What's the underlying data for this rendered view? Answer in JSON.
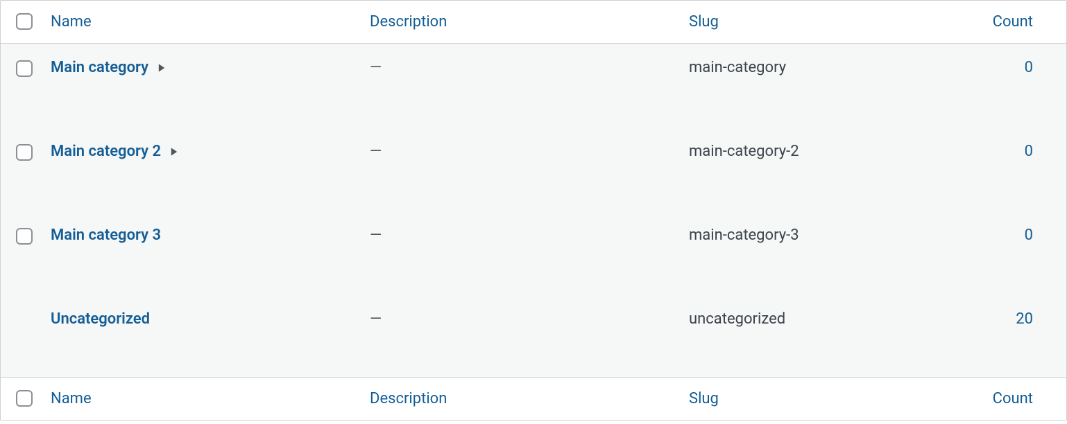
{
  "columns": {
    "name": "Name",
    "description": "Description",
    "slug": "Slug",
    "count": "Count"
  },
  "rows": [
    {
      "has_checkbox": true,
      "name": "Main category",
      "expandable": true,
      "description": "—",
      "slug": "main-category",
      "count": "0"
    },
    {
      "has_checkbox": true,
      "name": "Main category 2",
      "expandable": true,
      "description": "—",
      "slug": "main-category-2",
      "count": "0"
    },
    {
      "has_checkbox": true,
      "name": "Main category 3",
      "expandable": false,
      "description": "—",
      "slug": "main-category-3",
      "count": "0"
    },
    {
      "has_checkbox": false,
      "name": "Uncategorized",
      "expandable": false,
      "description": "—",
      "slug": "uncategorized",
      "count": "20"
    }
  ]
}
